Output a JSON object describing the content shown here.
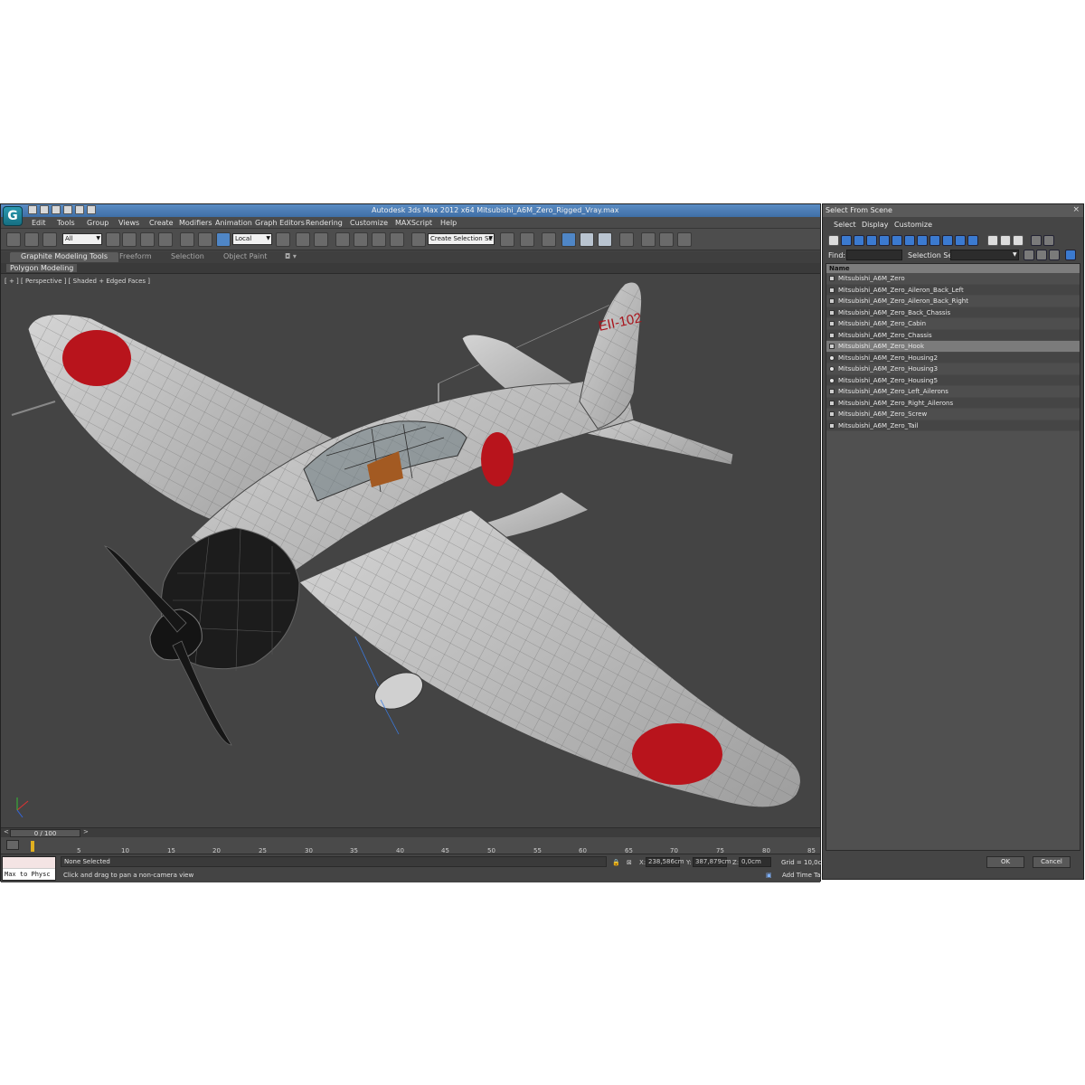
{
  "window": {
    "title": "Autodesk 3ds Max  2012 x64      Mitsubishi_A6M_Zero_Rigged_Vray.max",
    "app_logo": "G"
  },
  "menu": {
    "items": [
      "Edit",
      "Tools",
      "Group",
      "Views",
      "Create",
      "Modifiers",
      "Animation",
      "Graph Editors",
      "Rendering",
      "Customize",
      "MAXScript",
      "Help"
    ]
  },
  "toolbar": {
    "selection_filter": "All",
    "reference_coord": "Local",
    "named_selection": "Create Selection Se"
  },
  "ribbon": {
    "tabs": [
      "Graphite Modeling Tools",
      "Freeform",
      "Selection",
      "Object Paint"
    ],
    "panel_label": "Polygon Modeling"
  },
  "viewport": {
    "label": "[ + ] [ Perspective ] [ Shaded + Edged Faces ]",
    "tail_code": "EII-102",
    "colors": {
      "background": "#444444",
      "hull": "#c4c4c4",
      "hinomaru": "#b8141c",
      "cowling": "#1c1c1c"
    }
  },
  "timeline": {
    "frame_counter": "0 / 100",
    "prev_arrow": "<",
    "next_arrow": ">",
    "ticks": [
      "5",
      "10",
      "15",
      "20",
      "25",
      "30",
      "35",
      "40",
      "45",
      "50",
      "55",
      "60",
      "65",
      "70",
      "75",
      "80",
      "85"
    ]
  },
  "status": {
    "maxscript": "Max to Physc",
    "selection": "None Selected",
    "prompt": "Click and drag to pan a non-camera view",
    "x_label": "X:",
    "x_value": "238,586cm",
    "y_label": "Y:",
    "y_value": "387,879cm",
    "z_label": "Z:",
    "z_value": "0,0cm",
    "grid": "Grid = 10,0cm",
    "add_time_tag": "Add Time Tag"
  },
  "dialog": {
    "title": "Select From Scene",
    "close": "×",
    "menu": [
      "Select",
      "Display",
      "Customize"
    ],
    "find_label": "Find:",
    "selection_set_label": "Selection Set:",
    "column_header": "Name",
    "objects": [
      "Mitsubishi_A6M_Zero",
      "Mitsubishi_A6M_Zero_Aileron_Back_Left",
      "Mitsubishi_A6M_Zero_Aileron_Back_Right",
      "Mitsubishi_A6M_Zero_Back_Chassis",
      "Mitsubishi_A6M_Zero_Cabin",
      "Mitsubishi_A6M_Zero_Chassis",
      "Mitsubishi_A6M_Zero_Hook",
      "Mitsubishi_A6M_Zero_Housing2",
      "Mitsubishi_A6M_Zero_Housing3",
      "Mitsubishi_A6M_Zero_Housing5",
      "Mitsubishi_A6M_Zero_Left_Ailerons",
      "Mitsubishi_A6M_Zero_Right_Ailerons",
      "Mitsubishi_A6M_Zero_Screw",
      "Mitsubishi_A6M_Zero_Tail"
    ],
    "ok_label": "OK",
    "cancel_label": "Cancel"
  }
}
